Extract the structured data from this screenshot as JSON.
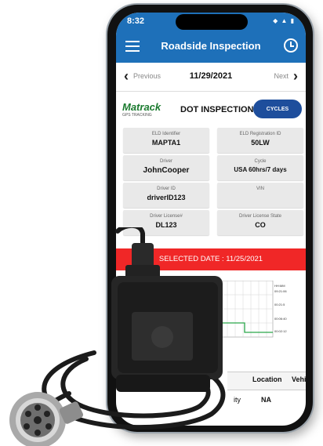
{
  "status_bar": {
    "time": "8:32",
    "icons": "◆ ▲ ▮"
  },
  "app_bar": {
    "title": "Roadside Inspection"
  },
  "date_nav": {
    "prev_label": "Previous",
    "date": "11/29/2021",
    "next_label": "Next"
  },
  "header": {
    "logo_text": "Matrack",
    "logo_sub": "GPS TRACKING",
    "title": "DOT INSPECTION",
    "cycles_label": "CYCLES"
  },
  "cards": [
    {
      "label": "ELD Identifier",
      "value": "MAPTA1"
    },
    {
      "label": "ELD Registration ID",
      "value": "50LW"
    },
    {
      "label": "Driver",
      "value": "JohnCooper"
    },
    {
      "label": "Cycle",
      "value": "USA 60hrs/7 days"
    },
    {
      "label": "Driver ID",
      "value": "driverID123"
    },
    {
      "label": "VIN",
      "value": ""
    },
    {
      "label": "Driver License#",
      "value": "DL123"
    },
    {
      "label": "Driver License State",
      "value": "CO"
    }
  ],
  "selected_date": "SELECTED DATE : 11/25/2021",
  "graph": {
    "right_labels": [
      "HH:MM",
      "09:21:06",
      "00:21:5",
      "00:06:40",
      "00:02:12"
    ]
  },
  "table": {
    "headers": [
      "Location",
      "Vehi"
    ],
    "row": [
      "ity",
      "NA"
    ]
  },
  "colors": {
    "primary": "#1e70b9",
    "banner": "#f02727",
    "button": "#1e4e9c",
    "logo_green": "#1a7a2e",
    "graph_line": "#2aa64a"
  }
}
